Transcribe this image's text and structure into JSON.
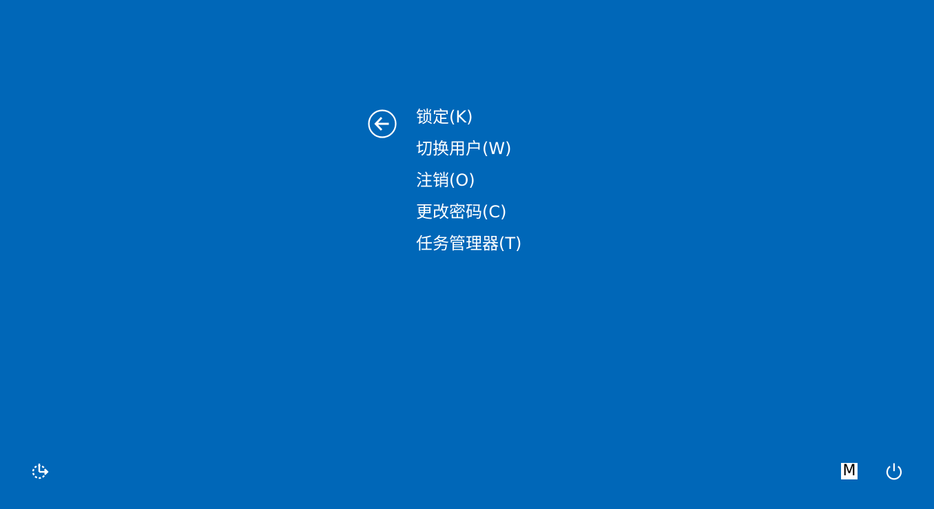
{
  "back_button": {
    "icon": "back-arrow-icon"
  },
  "menu": {
    "items": [
      {
        "label": "锁定(K)",
        "action": "lock"
      },
      {
        "label": "切换用户(W)",
        "action": "switch-user"
      },
      {
        "label": "注销(O)",
        "action": "sign-out"
      },
      {
        "label": "更改密码(C)",
        "action": "change-password"
      },
      {
        "label": "任务管理器(T)",
        "action": "task-manager"
      }
    ]
  },
  "bottom_bar": {
    "ease_of_access_icon": "ease-of-access-icon",
    "input_method_label": "M",
    "power_icon": "power-icon"
  },
  "colors": {
    "background": "#0067b8",
    "foreground": "#ffffff"
  }
}
